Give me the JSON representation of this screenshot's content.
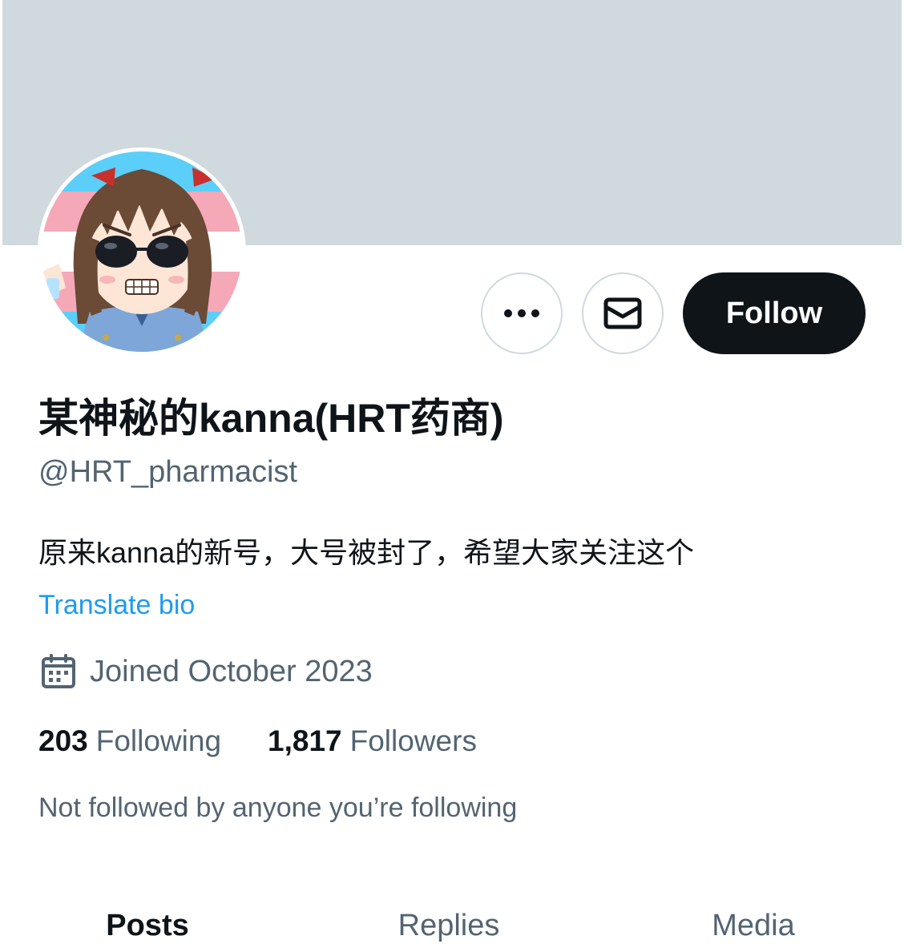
{
  "colors": {
    "banner": "#cfd9de",
    "follow_button_bg": "#0f1419",
    "link": "#1d9bf0",
    "secondary_text": "#536471"
  },
  "profile": {
    "display_name": "某神秘的kanna(HRT药商)",
    "handle": "@HRT_pharmacist",
    "bio": "原来kanna的新号，大号被封了，希望大家关注这个",
    "translate_label": "Translate bio",
    "joined": "Joined October 2023",
    "joined_icon": "calendar-icon",
    "avatar": "anime-character-avatar"
  },
  "actions": {
    "more_icon": "more-horizontal-icon",
    "message_icon": "envelope-icon",
    "follow_label": "Follow"
  },
  "stats": {
    "following_count": "203",
    "following_label": "Following",
    "followers_count": "1,817",
    "followers_label": "Followers"
  },
  "social_context": "Not followed by anyone you’re following",
  "tabs": [
    {
      "label": "Posts",
      "active": true
    },
    {
      "label": "Replies",
      "active": false
    },
    {
      "label": "Media",
      "active": false
    }
  ]
}
